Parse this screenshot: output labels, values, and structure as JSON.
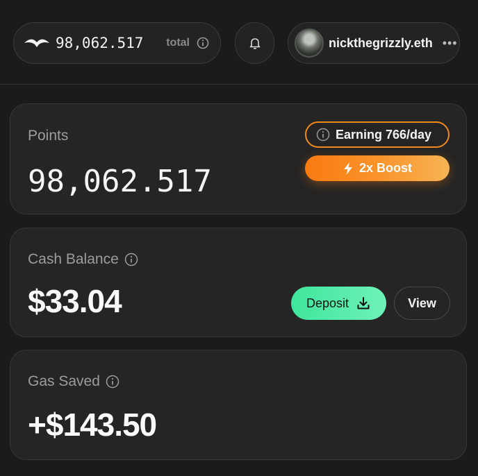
{
  "header": {
    "balance_value": "98,062.517",
    "balance_suffix": "total",
    "username": "nickthegrizzly.eth",
    "more_glyph": "•••"
  },
  "points": {
    "label": "Points",
    "value": "98,062.517",
    "earning": "Earning 766/day",
    "boost": "2x Boost"
  },
  "cash": {
    "label": "Cash Balance",
    "value": "$33.04",
    "deposit": "Deposit",
    "view": "View"
  },
  "gas": {
    "label": "Gas Saved",
    "value": "+$143.50"
  },
  "colors": {
    "background": "#1b1b1b",
    "card": "#252525",
    "orange": "#f97a12",
    "green": "#3fe59d"
  },
  "icons": [
    "bird-logo-icon",
    "info-icon",
    "bell-icon",
    "lightning-icon",
    "download-icon",
    "more-dots-icon"
  ]
}
